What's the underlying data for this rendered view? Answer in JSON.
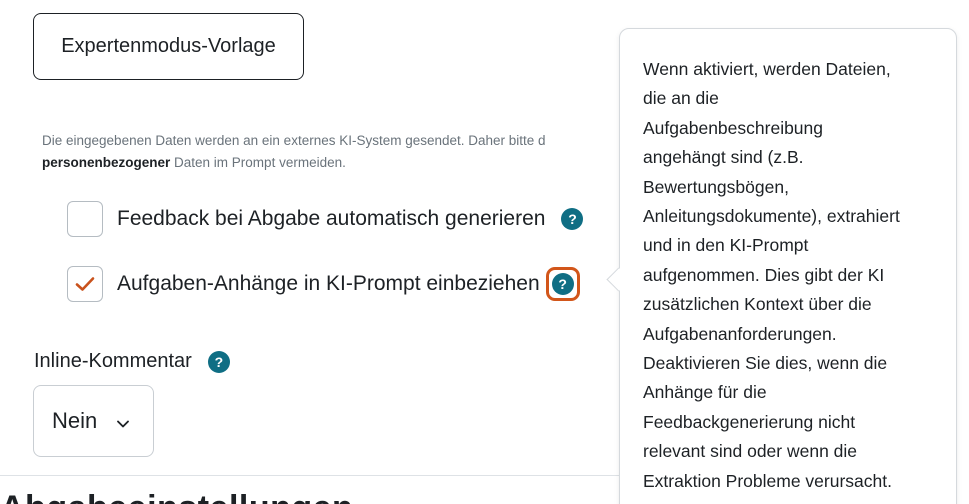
{
  "template_button": {
    "label": "Expertenmodus-Vorlage"
  },
  "notice": {
    "part1": "Die eingegebenen Daten werden an ein externes KI-System gesendet. Daher bitte d",
    "bold": "personenbezogener",
    "part2": " Daten im Prompt vermeiden."
  },
  "options": {
    "auto_feedback": {
      "label": "Feedback bei Abgabe automatisch generieren",
      "checked": false
    },
    "include_attachments": {
      "label": "Aufgaben-Anhänge in KI-Prompt einbeziehen",
      "checked": true
    }
  },
  "help_icon_glyph": "?",
  "inline_comment": {
    "label": "Inline-Kommentar",
    "selected": "Nein"
  },
  "section_heading_cut": "Abgabeeinstellungen",
  "popover": {
    "lines": [
      "Wenn aktiviert, werden Dateien,",
      "die an die",
      "Aufgabenbeschreibung",
      "angehängt sind (z.B.",
      "Bewertungsbögen,",
      "Anleitungsdokumente), extrahiert",
      "und in den KI-Prompt",
      "aufgenommen. Dies gibt der KI",
      "zusätzlichen Kontext über die",
      "Aufgabenanforderungen.",
      "Deaktivieren Sie dies, wenn die",
      "Anhänge für die",
      "Feedbackgenerierung nicht",
      "relevant sind oder wenn die",
      "Extraktion Probleme verursacht."
    ]
  },
  "colors": {
    "help_icon": "#0f6e84",
    "focus_ring": "#d2561a",
    "checkmark": "#c9521c"
  },
  "icons": {
    "help": "help-icon",
    "check": "checkmark-icon",
    "chevron": "chevron-down-icon"
  }
}
